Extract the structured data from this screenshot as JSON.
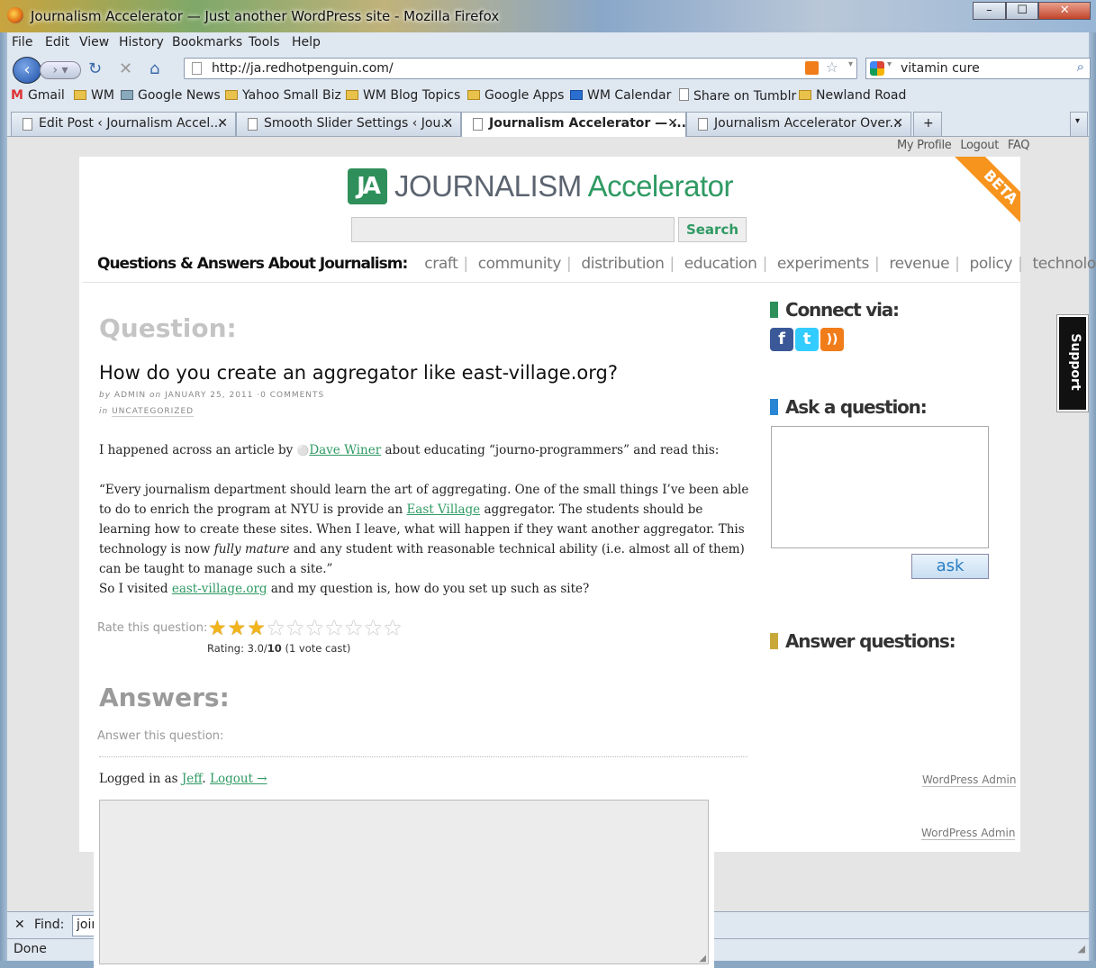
{
  "window": {
    "title": "Journalism Accelerator — Just another WordPress site - Mozilla Firefox",
    "controls": [
      "–",
      "☐",
      "✕"
    ]
  },
  "menu": [
    "File",
    "Edit",
    "View",
    "History",
    "Bookmarks",
    "Tools",
    "Help"
  ],
  "nav": {
    "url": "http://ja.redhotpenguin.com/",
    "search_value": "vitamin cure"
  },
  "bookmarks": [
    "Gmail",
    "WM",
    "Google News",
    "Yahoo Small Biz",
    "WM Blog Topics",
    "Google Apps",
    "WM Calendar",
    "Share on Tumblr",
    "Newland Road"
  ],
  "tabs": [
    {
      "label": "Edit Post ‹ Journalism Accel..."
    },
    {
      "label": "Smooth Slider Settings ‹ Jou..."
    },
    {
      "label": "Journalism Accelerator — ..."
    },
    {
      "label": "Journalism Accelerator Over..."
    }
  ],
  "toplinks": [
    "My Profile",
    "Logout",
    "FAQ"
  ],
  "logo": {
    "mark": "JA",
    "word1": "JOURNALISM",
    "word2": "Accelerator",
    "badge": "BETA"
  },
  "search": {
    "button": "Search"
  },
  "categories": {
    "label": "Questions & Answers About Journalism:",
    "items": [
      "craft",
      "community",
      "distribution",
      "education",
      "experiments",
      "revenue",
      "policy",
      "technology"
    ]
  },
  "question": {
    "heading": "Question:",
    "title": "How do you create an aggregator like east-village.org?",
    "by": "by",
    "author": "ADMIN",
    "on": "on",
    "date": "JANUARY 25, 2011",
    "comments": "0 COMMENTS",
    "in": "in",
    "category": "UNCATEGORIZED",
    "p1_before": "I happened across an article by",
    "p1_link": "Dave Winer",
    "p1_after": "about educating “journo-programmers” and read this:",
    "p2_a": "“Every journalism department should learn the art of aggregating. One of the small things I’ve been able to do to enrich the program at NYU is provide an",
    "p2_link": "East Village",
    "p2_b": "aggregator. The students should be learning how to create these sites. When I leave, what will happen if they want another aggregator. This technology is now",
    "p2_em": "fully mature",
    "p2_c": "and any student with reasonable technical ability (i.e. almost all of them) can be taught to manage such a site.”",
    "p3_before": "So I visited",
    "p3_link": "east-village.org",
    "p3_after": "and my question is, how do you set up such as site?",
    "rate_label": "Rate this question:",
    "rating_value": 3,
    "rating_max": 10,
    "rating_prefix": "Rating: 3.0/",
    "rating_max_text": "10",
    "rating_suffix": "(1 vote cast)"
  },
  "answers": {
    "heading": "Answers:",
    "label": "Answer this question:",
    "logged_prefix": "Logged in as",
    "user": "Jeff",
    "logout": "Logout →"
  },
  "sidebar": {
    "connect": "Connect via:",
    "ask": "Ask a question:",
    "ask_button": "ask",
    "answer": "Answer questions:",
    "wp_admin": "WordPress Admin",
    "support": "Support"
  },
  "findbar": {
    "label": "Find:",
    "value": "join"
  },
  "status": {
    "text": "Done"
  },
  "colors": {
    "accent": "#2f9a63",
    "beta": "#f7941d",
    "connect": "#2f8f5a",
    "ask": "#2a86d4",
    "answer": "#c9a83a"
  }
}
